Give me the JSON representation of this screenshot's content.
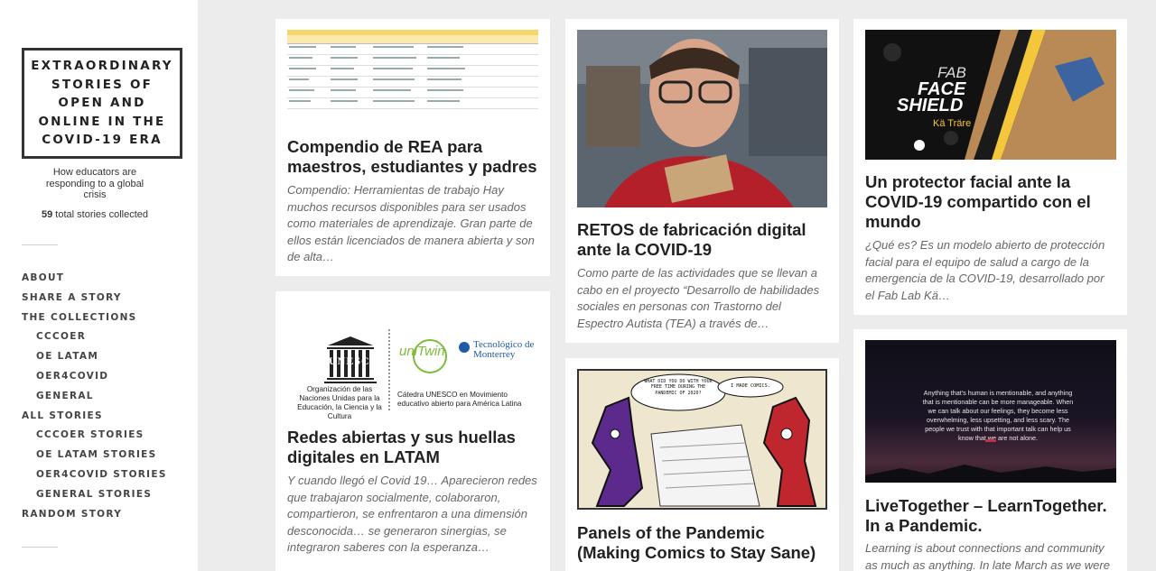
{
  "site": {
    "title": "EXTRAORDINARY STORIES OF OPEN AND ONLINE IN THE COVID-19 ERA",
    "tagline": "How educators are responding to a global crisis",
    "count_number": "59",
    "count_suffix": "total stories collected"
  },
  "nav": [
    {
      "label": "ABOUT",
      "sub": false
    },
    {
      "label": "SHARE A STORY",
      "sub": false
    },
    {
      "label": "THE COLLECTIONS",
      "sub": false
    },
    {
      "label": "CCCOER",
      "sub": true
    },
    {
      "label": "OE LATAM",
      "sub": true
    },
    {
      "label": "OER4COVID",
      "sub": true
    },
    {
      "label": "GENERAL",
      "sub": true
    },
    {
      "label": "ALL STORIES",
      "sub": false
    },
    {
      "label": "CCCOER STORIES",
      "sub": true
    },
    {
      "label": "OE LATAM STORIES",
      "sub": true
    },
    {
      "label": "OER4COVID STORIES",
      "sub": true
    },
    {
      "label": "GENERAL STORIES",
      "sub": true
    },
    {
      "label": "RANDOM STORY",
      "sub": false
    }
  ],
  "cards": [
    {
      "title": "Compendio de REA para maestros, estudiantes y padres",
      "excerpt": "Compendio: Herramientas de trabajo  Hay muchos recursos disponibles para ser usados como materiales de aprendizaje. Gran parte de ellos están licenciados de manera abierta y son de alta…",
      "image": "spreadsheet-thumbnail"
    },
    {
      "title": "Redes abiertas y sus huellas digitales en LATAM",
      "excerpt": "Y cuando llegó el Covid 19… Aparecieron redes que trabajaron socialmente, colaboraron, compartieron, se enfrentaron a una dimensión desconocida… se generaron sinergias, se integraron saberes con la esperanza…",
      "image": "unesco-logos",
      "image_text": {
        "unesco": "UNESCO",
        "unesco_caption": "Organización de las Naciones Unidas para la Educación, la Ciencia y la Cultura",
        "unitwin": "uniTwin",
        "unitwin_caption": "Cátedra UNESCO en Movimiento educativo abierto para América Latina",
        "tec": "Tecnológico de Monterrey"
      }
    },
    {
      "title": "RETOS de fabricación digital ante la COVID-19",
      "excerpt": "Como parte de las actividades que se llevan a cabo en el proyecto “Desarrollo de habilidades sociales en personas con Trastorno del Espectro Autista (TEA) a través de…",
      "image": "student-photo"
    },
    {
      "title": "Panels of the Pandemic (Making Comics to Stay Sane)",
      "excerpt": "",
      "image": "comic-panel",
      "image_text": {
        "bubble_left": "WHAT DID YOU DO WITH YOUR FREE TIME DURING THE PANDEMIC OF 2020?",
        "bubble_right": "I MADE COMICS."
      }
    },
    {
      "title": "Un protector facial ante la COVID-19 compartido con el mundo",
      "excerpt": "¿Qué es? Es un modelo abierto de protección facial para el equipo de salud a cargo de la emergencia de la COVID-19, desarrollado por el Fab Lab Kä…",
      "image": "face-shield-poster",
      "image_text": {
        "fab": "FAB",
        "face": "FACE",
        "shield": "SHIELD",
        "brand": "Kä Träre"
      }
    },
    {
      "title": "LiveTogether – LearnTogether. In a Pandemic.",
      "excerpt": "Learning is about connections  and community as much as anything.  In late March as we were",
      "image": "quote-dusk",
      "image_text": {
        "quote": "Anything that’s human is mentionable, and anything that is mentionable can be more manageable. When we can talk about our feelings, they become less overwhelming, less upsetting, and less scary. The people we trust with that important talk can help us know that we are not alone."
      }
    }
  ],
  "colors": {
    "background": "#ececec",
    "card": "#ffffff",
    "title": "#222222",
    "excerpt": "#666666"
  }
}
